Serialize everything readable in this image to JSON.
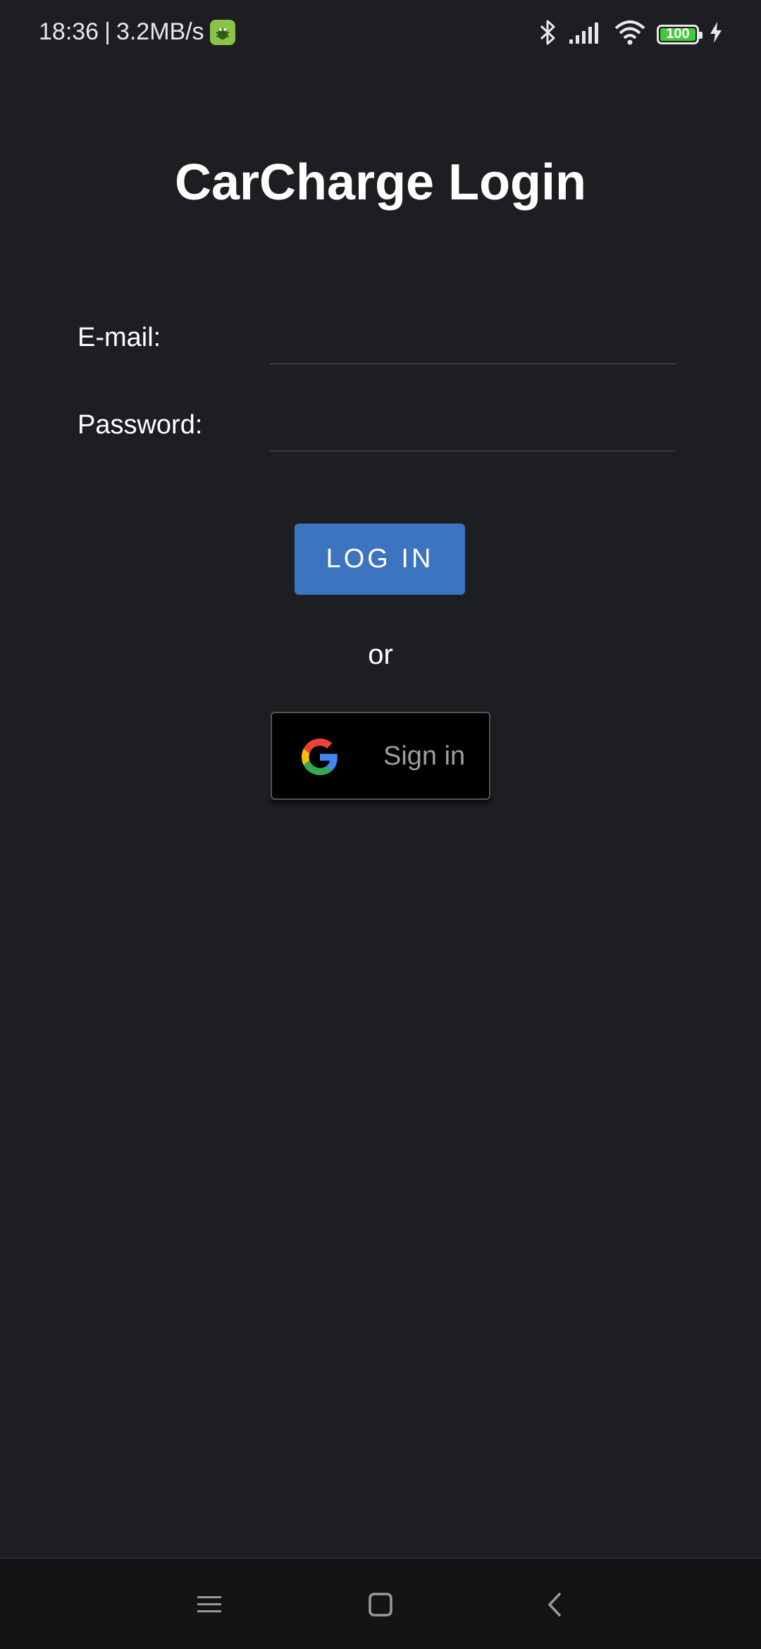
{
  "status_bar": {
    "time": "18:36",
    "separator": "|",
    "network_speed": "3.2MB/s",
    "battery_level": "100",
    "icons": [
      "bug-icon",
      "bluetooth-icon",
      "signal-icon",
      "wifi-icon",
      "battery-icon",
      "charging-icon"
    ]
  },
  "login": {
    "title": "CarCharge Login",
    "email_label": "E-mail:",
    "email_value": "",
    "password_label": "Password:",
    "password_value": "",
    "login_button": "LOG IN",
    "or_text": "or",
    "google_button": "Sign in"
  },
  "nav_bar": {
    "icons": [
      "menu-icon",
      "home-icon",
      "back-icon"
    ]
  },
  "colors": {
    "background": "#1d1e22",
    "accent": "#3d74bf",
    "nav_background": "#141416"
  }
}
